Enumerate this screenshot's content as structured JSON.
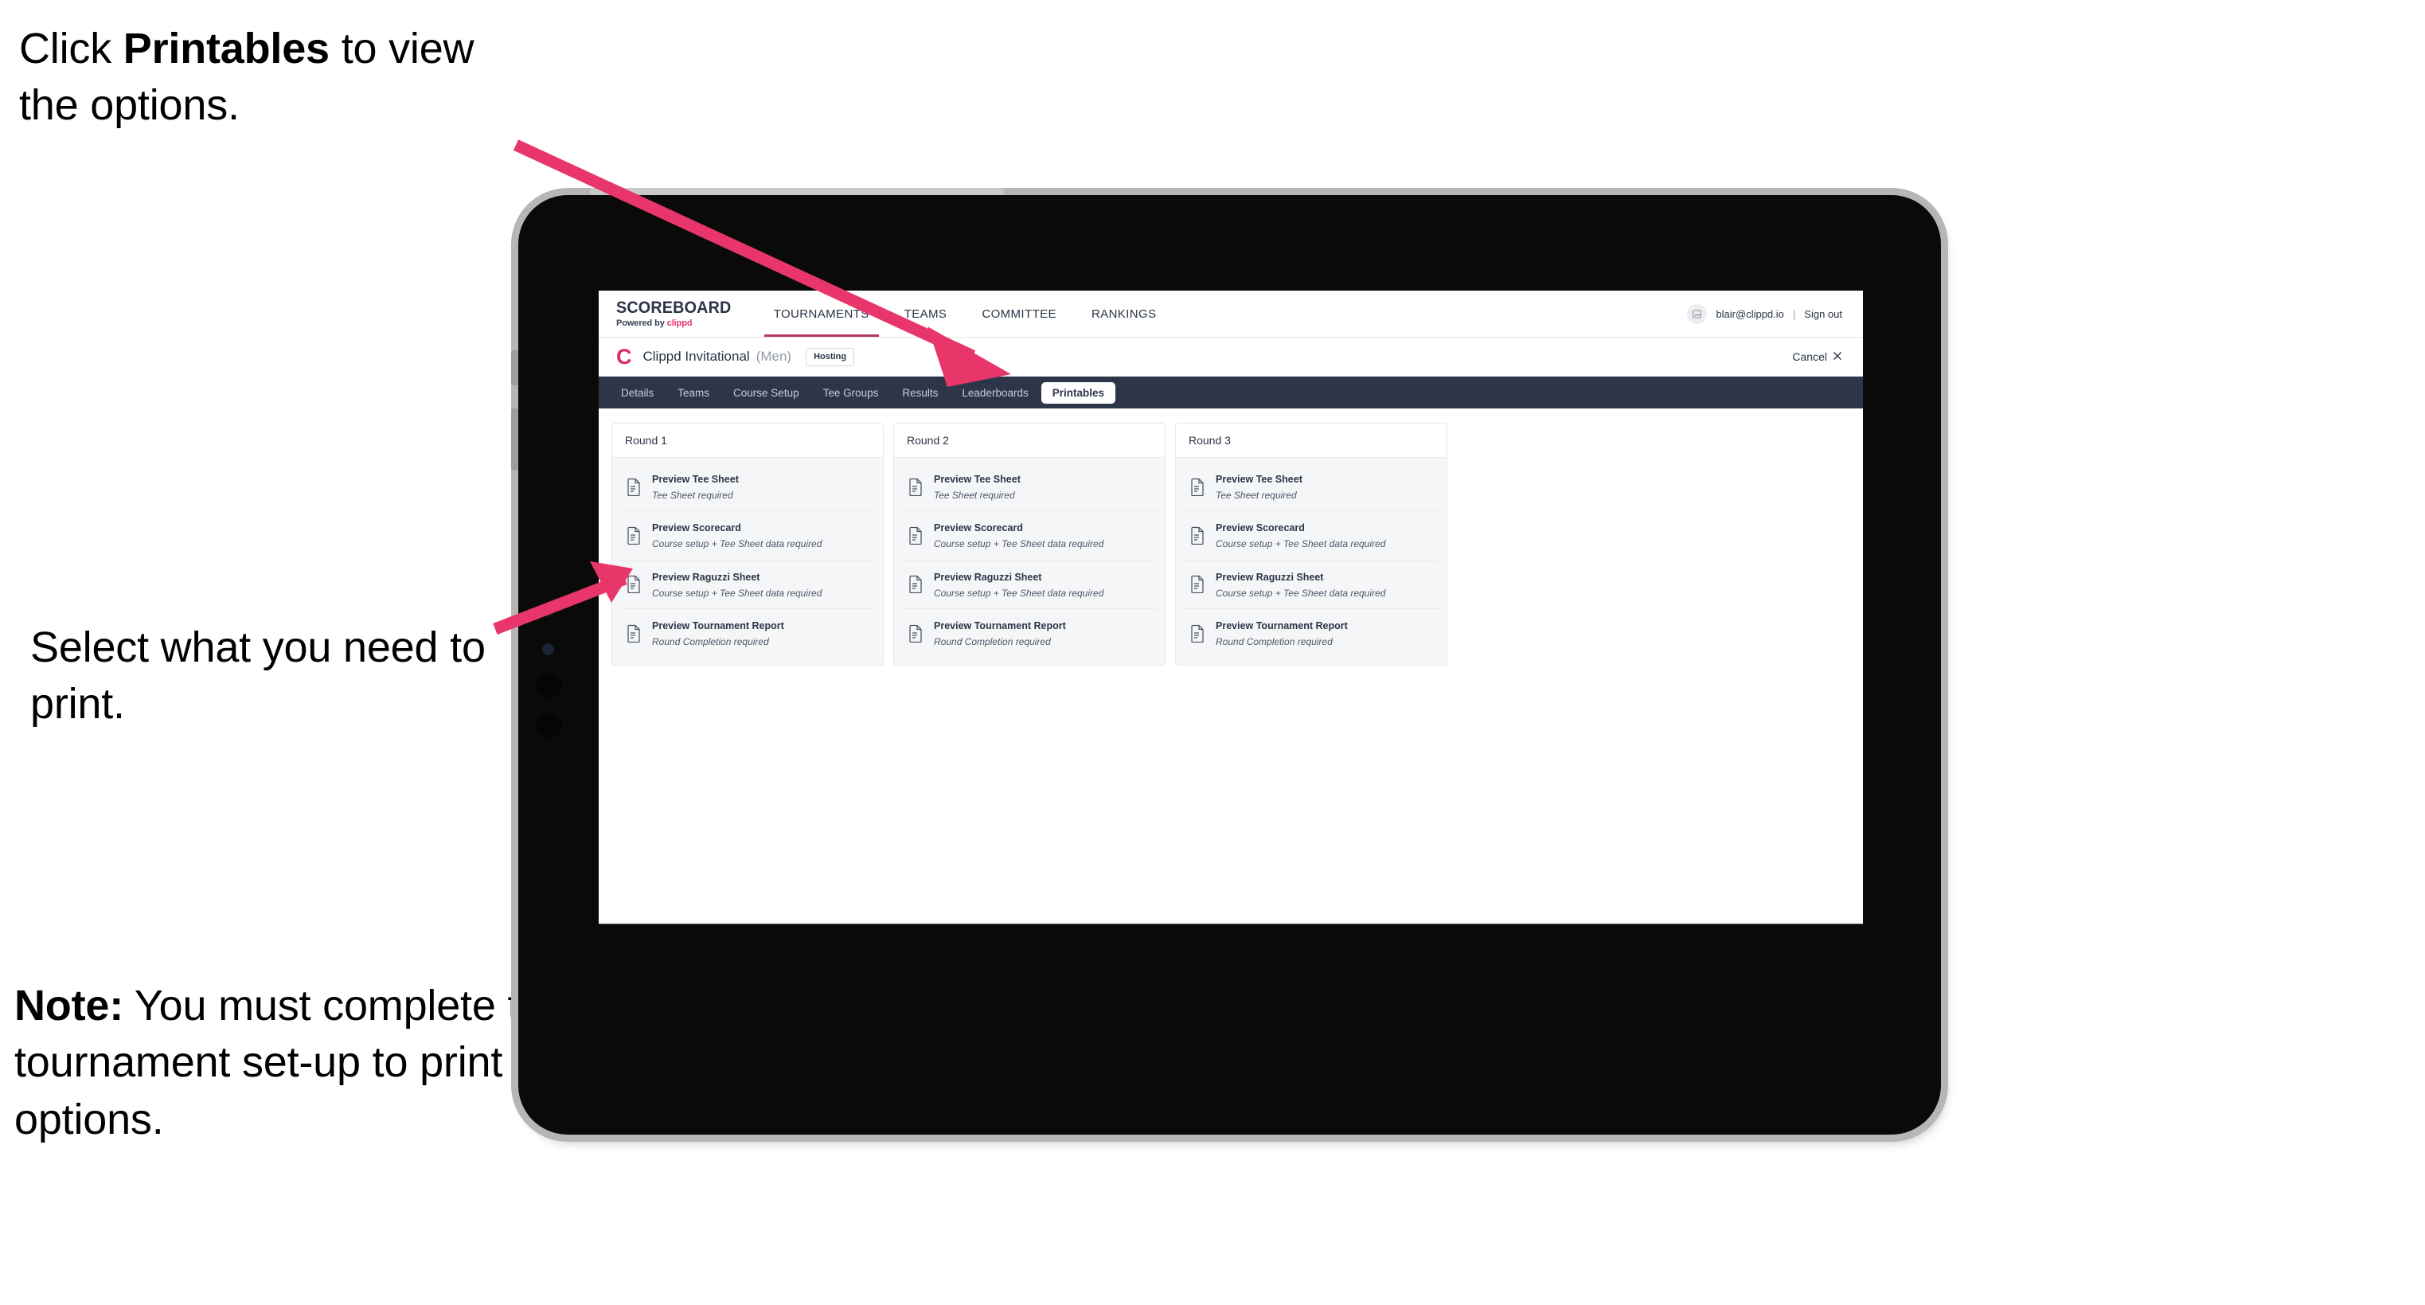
{
  "annotations": {
    "click_instruction": {
      "prefix": "Click ",
      "bold": "Printables",
      "suffix": " to view the options."
    },
    "select_instruction": "Select what you need to print.",
    "note": {
      "bold": "Note:",
      "text": " You must complete the tournament set-up to print all the options."
    },
    "arrow_color": "#e8366b"
  },
  "device": {
    "type": "tablet",
    "bezel_color": "#0a0a0a",
    "frame_color": "#b6b6b6"
  },
  "app": {
    "brand": {
      "title": "SCOREBOARD",
      "tagline_prefix": "Powered by ",
      "tagline_brand": "clippd"
    },
    "topnav": [
      {
        "label": "TOURNAMENTS",
        "active": true
      },
      {
        "label": "TEAMS",
        "active": false
      },
      {
        "label": "COMMITTEE",
        "active": false
      },
      {
        "label": "RANKINGS",
        "active": false
      }
    ],
    "account": {
      "avatar_icon": "user-avatar-icon",
      "email": "blair@clippd.io",
      "separator": "|",
      "sign_out_label": "Sign out"
    },
    "tournament": {
      "logo_letter": "C",
      "name": "Clippd Invitational",
      "gender": "(Men)",
      "status_badge": "Hosting",
      "cancel_label": "Cancel",
      "cancel_icon": "close-icon"
    },
    "tabs": [
      {
        "label": "Details",
        "active": false
      },
      {
        "label": "Teams",
        "active": false
      },
      {
        "label": "Course Setup",
        "active": false
      },
      {
        "label": "Tee Groups",
        "active": false
      },
      {
        "label": "Results",
        "active": false
      },
      {
        "label": "Leaderboards",
        "active": false
      },
      {
        "label": "Printables",
        "active": true
      }
    ],
    "rounds": [
      {
        "title": "Round 1",
        "items": [
          {
            "icon": "document-icon",
            "title": "Preview Tee Sheet",
            "requirement": "Tee Sheet required"
          },
          {
            "icon": "document-icon",
            "title": "Preview Scorecard",
            "requirement": "Course setup + Tee Sheet data required"
          },
          {
            "icon": "document-icon",
            "title": "Preview Raguzzi Sheet",
            "requirement": "Course setup + Tee Sheet data required"
          },
          {
            "icon": "document-icon",
            "title": "Preview Tournament Report",
            "requirement": "Round Completion required"
          }
        ]
      },
      {
        "title": "Round 2",
        "items": [
          {
            "icon": "document-icon",
            "title": "Preview Tee Sheet",
            "requirement": "Tee Sheet required"
          },
          {
            "icon": "document-icon",
            "title": "Preview Scorecard",
            "requirement": "Course setup + Tee Sheet data required"
          },
          {
            "icon": "document-icon",
            "title": "Preview Raguzzi Sheet",
            "requirement": "Course setup + Tee Sheet data required"
          },
          {
            "icon": "document-icon",
            "title": "Preview Tournament Report",
            "requirement": "Round Completion required"
          }
        ]
      },
      {
        "title": "Round 3",
        "items": [
          {
            "icon": "document-icon",
            "title": "Preview Tee Sheet",
            "requirement": "Tee Sheet required"
          },
          {
            "icon": "document-icon",
            "title": "Preview Scorecard",
            "requirement": "Course setup + Tee Sheet data required"
          },
          {
            "icon": "document-icon",
            "title": "Preview Raguzzi Sheet",
            "requirement": "Course setup + Tee Sheet data required"
          },
          {
            "icon": "document-icon",
            "title": "Preview Tournament Report",
            "requirement": "Round Completion required"
          }
        ]
      }
    ],
    "colors": {
      "tabbar_bg": "#2c3648",
      "accent_pink": "#e02a5f",
      "text_dark": "#2b3446"
    }
  }
}
